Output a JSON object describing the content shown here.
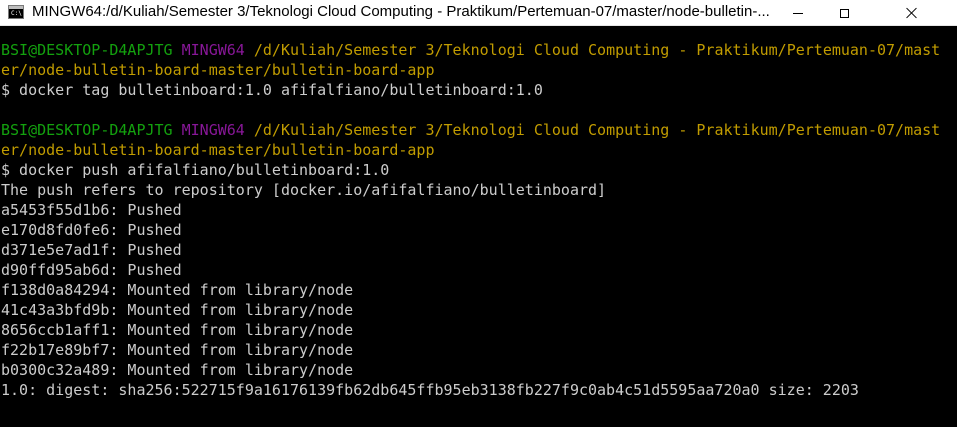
{
  "window": {
    "title": "MINGW64:/d/Kuliah/Semester 3/Teknologi Cloud Computing - Praktikum/Pertemuan-07/master/node-bulletin-..."
  },
  "icons": {
    "app": "terminal-app-icon",
    "minimize": "minimize-icon",
    "maximize": "maximize-icon",
    "close": "close-icon"
  },
  "colors": {
    "user_host": "#13a10e",
    "shell": "#881798",
    "path": "#c19c00",
    "text": "#cccccc",
    "background": "#000000"
  },
  "prompt1": {
    "user_host": "BSI@DESKTOP-D4APJTG",
    "shell": "MINGW64",
    "path_line1": "/d/Kuliah/Semester 3/Teknologi Cloud Computing - Praktikum/Pertemuan-07/mast",
    "path_line2": "er/node-bulletin-board-master/bulletin-board-app",
    "command": "$ docker tag bulletinboard:1.0 afifalfiano/bulletinboard:1.0"
  },
  "prompt2": {
    "user_host": "BSI@DESKTOP-D4APJTG",
    "shell": "MINGW64",
    "path_line1": "/d/Kuliah/Semester 3/Teknologi Cloud Computing - Praktikum/Pertemuan-07/mast",
    "path_line2": "er/node-bulletin-board-master/bulletin-board-app",
    "command": "$ docker push afifalfiano/bulletinboard:1.0"
  },
  "output": [
    "The push refers to repository [docker.io/afifalfiano/bulletinboard]",
    "a5453f55d1b6: Pushed",
    "e170d8fd0fe6: Pushed",
    "d371e5e7ad1f: Pushed",
    "d90ffd95ab6d: Pushed",
    "f138d0a84294: Mounted from library/node",
    "41c43a3bfd9b: Mounted from library/node",
    "8656ccb1aff1: Mounted from library/node",
    "f22b17e89bf7: Mounted from library/node",
    "b0300c32a489: Mounted from library/node",
    "1.0: digest: sha256:522715f9a16176139fb62db645ffb95eb3138fb227f9c0ab4c51d5595aa720a0 size: 2203"
  ]
}
